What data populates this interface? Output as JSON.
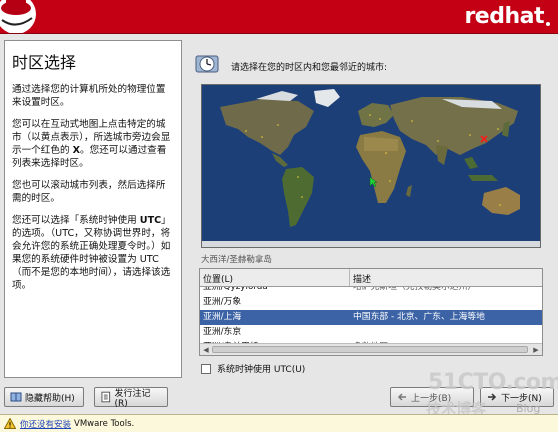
{
  "header": {
    "brand": "redhat"
  },
  "help": {
    "title": "时区选择",
    "p1": "通过选择您的计算机所处的物理位置来设置时区。",
    "p2_a": "您可以在互动式地图上点击特定的城市（以黄点表示），所选城市旁边会显示一个红色的 ",
    "p2_x": "X",
    "p2_b": "。您还可以通过查看列表来选择时区。",
    "p3": "您也可以滚动城市列表，然后选择所需的时区。",
    "p4_a": "您还可以选择「系统时钟使用 ",
    "p4_utc": "UTC",
    "p4_b": "」的选项。（UTC，又称协调世界时，将会允许您的系统正确处理夏令时。）如果您的系统硬件时钟被设置为 UTC（而不是您的本地时间），请选择该选项。"
  },
  "main": {
    "prompt": "请选择在您的时区内和您最邻近的城市:",
    "hover_city": "大西洋/圣赫勒拿岛"
  },
  "table": {
    "col_location": "位置(L)",
    "col_desc": "描述",
    "rows": [
      {
        "location": "亚洲/Qyzylorda",
        "desc": "哈萨克斯坦（克孜勒奥尔达州）",
        "selected": false,
        "clipped": true
      },
      {
        "location": "亚洲/万象",
        "desc": "",
        "selected": false,
        "clipped": false
      },
      {
        "location": "亚洲/上海",
        "desc": "中国东部 - 北京、广东、上海等地",
        "selected": true,
        "clipped": false
      },
      {
        "location": "亚洲/东京",
        "desc": "",
        "selected": false,
        "clipped": false
      },
      {
        "location": "亚洲/乌兰巴托",
        "desc": "多数地区",
        "selected": false,
        "clipped": false
      }
    ]
  },
  "utc_checkbox": {
    "label": "系统时钟使用 UTC(U)",
    "checked": false
  },
  "buttons": {
    "hide_help": "隐藏帮助(H)",
    "release_notes": "发行注记(R)",
    "back": "上一步(B)",
    "next": "下一步(N)"
  },
  "watermark": {
    "site": "51CTO.com",
    "subtitle": "技术博客",
    "blog": "Blog"
  },
  "vmware_bar": {
    "link": "你还没有安装",
    "text": "VMware Tools."
  },
  "colors": {
    "header": "#c40014",
    "selection": "#3b63a6",
    "ocean": "#1c3f78"
  }
}
